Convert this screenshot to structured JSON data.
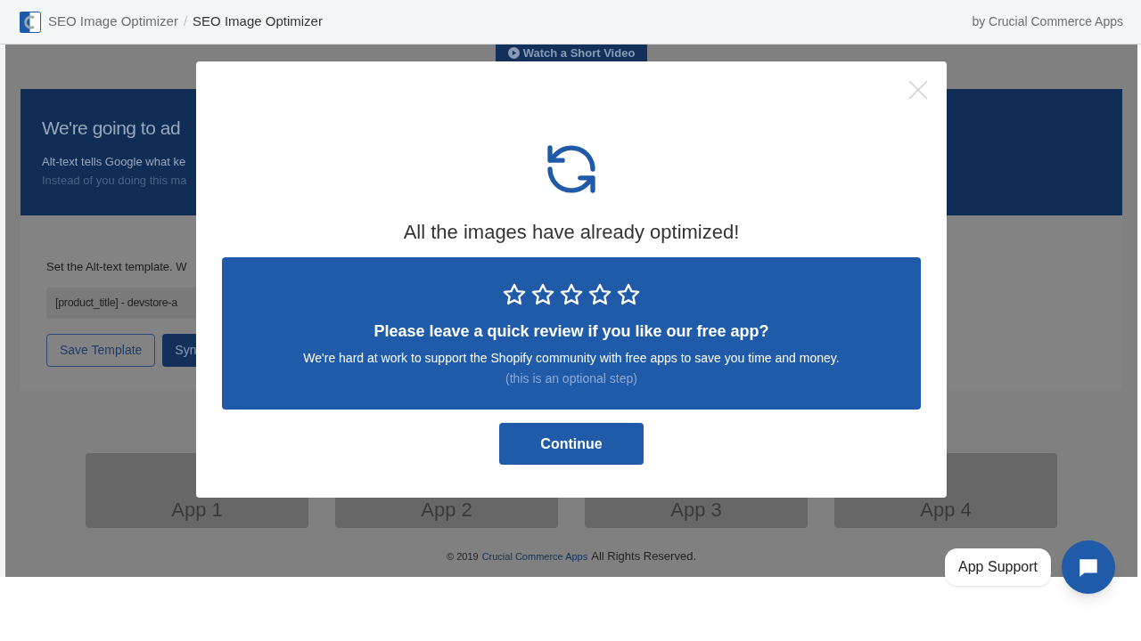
{
  "header": {
    "breadcrumb": [
      "SEO Image Optimizer",
      "SEO Image Optimizer"
    ],
    "separator": "/",
    "byline": "by Crucial Commerce Apps"
  },
  "background": {
    "video_button": "Watch a Short Video",
    "banner": {
      "title": "We're going to ad",
      "line_1": "Alt-text tells Google what ke",
      "line_2": "Instead of you doing this ma"
    },
    "template": {
      "label": "Set the Alt-text template. W",
      "value": "[product_title] - devstore-a",
      "buttons": [
        {
          "label": "Save Template",
          "kind": "outline"
        },
        {
          "label": "Syn",
          "kind": "solid"
        }
      ]
    },
    "app_cards": [
      "App 1",
      "App 2",
      "App 3",
      "App 4"
    ],
    "footer": {
      "prefix": "© 2019",
      "link": "Crucial Commerce Apps",
      "suffix": "All Rights Reserved."
    }
  },
  "modal": {
    "title": "All the images have already optimized!",
    "review": {
      "stars": 0,
      "heading": "Please leave a quick review if you like our free app?",
      "text": "We're hard at work to support the Shopify community with free apps to save you time and money.",
      "note": "(this is an optional step)"
    },
    "continue": "Continue"
  },
  "support": {
    "label": "App Support"
  }
}
